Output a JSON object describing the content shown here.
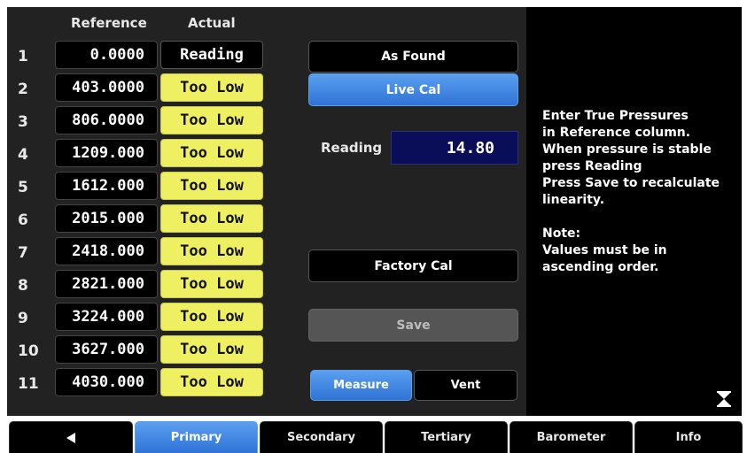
{
  "table": {
    "header_reference": "Reference",
    "header_actual": "Actual",
    "rows": [
      {
        "num": "1",
        "reference": "0.0000",
        "actual": "Reading"
      },
      {
        "num": "2",
        "reference": "403.0000",
        "actual": "Too Low"
      },
      {
        "num": "3",
        "reference": "806.0000",
        "actual": "Too Low"
      },
      {
        "num": "4",
        "reference": "1209.000",
        "actual": "Too Low"
      },
      {
        "num": "5",
        "reference": "1612.000",
        "actual": "Too Low"
      },
      {
        "num": "6",
        "reference": "2015.000",
        "actual": "Too Low"
      },
      {
        "num": "7",
        "reference": "2418.000",
        "actual": "Too Low"
      },
      {
        "num": "8",
        "reference": "2821.000",
        "actual": "Too Low"
      },
      {
        "num": "9",
        "reference": "3224.000",
        "actual": "Too Low"
      },
      {
        "num": "10",
        "reference": "3627.000",
        "actual": "Too Low"
      },
      {
        "num": "11",
        "reference": "4030.000",
        "actual": "Too Low"
      }
    ]
  },
  "controls": {
    "as_found": "As Found",
    "live_cal": "Live Cal",
    "reading_label": "Reading",
    "reading_value": "14.80",
    "factory_cal": "Factory Cal",
    "save": "Save",
    "measure": "Measure",
    "vent": "Vent"
  },
  "info": {
    "lines": [
      "Enter True Pressures",
      "in Reference column.",
      "When pressure is stable",
      "press Reading",
      "Press Save to recalculate",
      "linearity."
    ],
    "note_title": "Note:",
    "note_lines": [
      "Values must be in",
      "ascending order."
    ]
  },
  "tabs": {
    "back_icon": "left-triangle-icon",
    "primary": "Primary",
    "secondary": "Secondary",
    "tertiary": "Tertiary",
    "barometer": "Barometer",
    "info": "Info"
  },
  "colors": {
    "accent_blue": "#3b82e0",
    "warning_yellow": "#eff061",
    "reading_bg": "#0a0d57"
  }
}
